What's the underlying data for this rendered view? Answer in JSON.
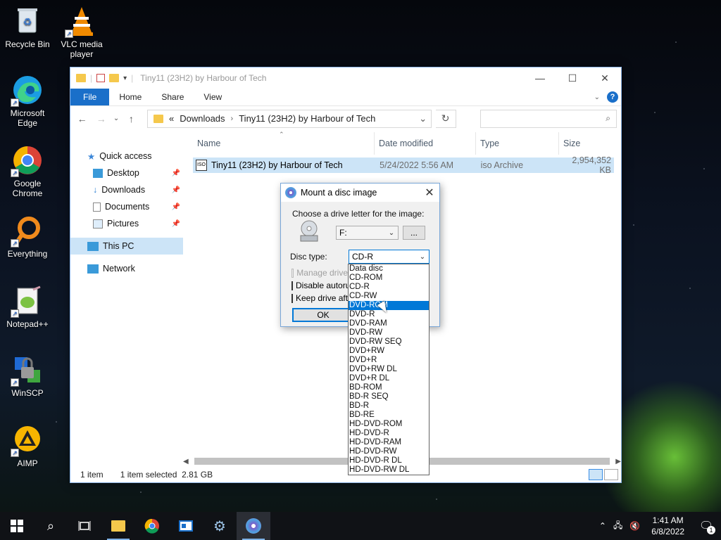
{
  "desktop": {
    "icons": [
      {
        "label": "Recycle Bin",
        "icon": "recycle-bin-icon"
      },
      {
        "label": "VLC media player",
        "icon": "vlc-icon"
      },
      {
        "label": "Microsoft Edge",
        "icon": "edge-icon"
      },
      {
        "label": "Google Chrome",
        "icon": "chrome-icon"
      },
      {
        "label": "Everything",
        "icon": "everything-icon"
      },
      {
        "label": "Notepad++",
        "icon": "notepadpp-icon"
      },
      {
        "label": "WinSCP",
        "icon": "winscp-icon"
      },
      {
        "label": "AIMP",
        "icon": "aimp-icon"
      }
    ]
  },
  "explorer": {
    "title": "Tiny11 (23H2) by Harbour of Tech",
    "ribbon": {
      "file": "File",
      "home": "Home",
      "share": "Share",
      "view": "View"
    },
    "address": {
      "prefix": "«",
      "crumbs": [
        "Downloads",
        "Tiny11 (23H2) by Harbour of Tech"
      ]
    },
    "nav": {
      "quick_access": "Quick access",
      "desktop": "Desktop",
      "downloads": "Downloads",
      "documents": "Documents",
      "pictures": "Pictures",
      "this_pc": "This PC",
      "network": "Network"
    },
    "columns": {
      "name": "Name",
      "date": "Date modified",
      "type": "Type",
      "size": "Size"
    },
    "file": {
      "name": "Tiny11 (23H2) by Harbour of Tech",
      "date": "5/24/2022 5:56 AM",
      "type": "iso Archive",
      "size": "2,954,352 KB"
    },
    "status": {
      "items": "1 item",
      "selected": "1 item selected  2.81 GB"
    }
  },
  "dialog": {
    "title": "Mount a disc image",
    "choose_label": "Choose a drive letter for the image:",
    "drive_value": "F:",
    "browse_label": "...",
    "disc_type_label": "Disc type:",
    "disc_type_value": "CD-R",
    "check_manage": "Manage drive",
    "check_disable": "Disable autorun",
    "check_keep": "Keep drive after",
    "ok_label": "OK",
    "options": [
      "Data disc",
      "CD-ROM",
      "CD-R",
      "CD-RW",
      "DVD-ROM",
      "DVD-R",
      "DVD-RAM",
      "DVD-RW",
      "DVD-RW SEQ",
      "DVD+RW",
      "DVD+R",
      "DVD+RW DL",
      "DVD+R DL",
      "BD-ROM",
      "BD-R SEQ",
      "BD-R",
      "BD-RE",
      "HD-DVD-ROM",
      "HD-DVD-R",
      "HD-DVD-RAM",
      "HD-DVD-RW",
      "HD-DVD-R DL",
      "HD-DVD-RW DL"
    ],
    "highlighted_option": "DVD-ROM"
  },
  "taskbar": {
    "time": "1:41 AM",
    "date": "6/8/2022",
    "notification_count": "1"
  },
  "colors": {
    "accent": "#0078d7",
    "selection": "#cce4f7"
  }
}
